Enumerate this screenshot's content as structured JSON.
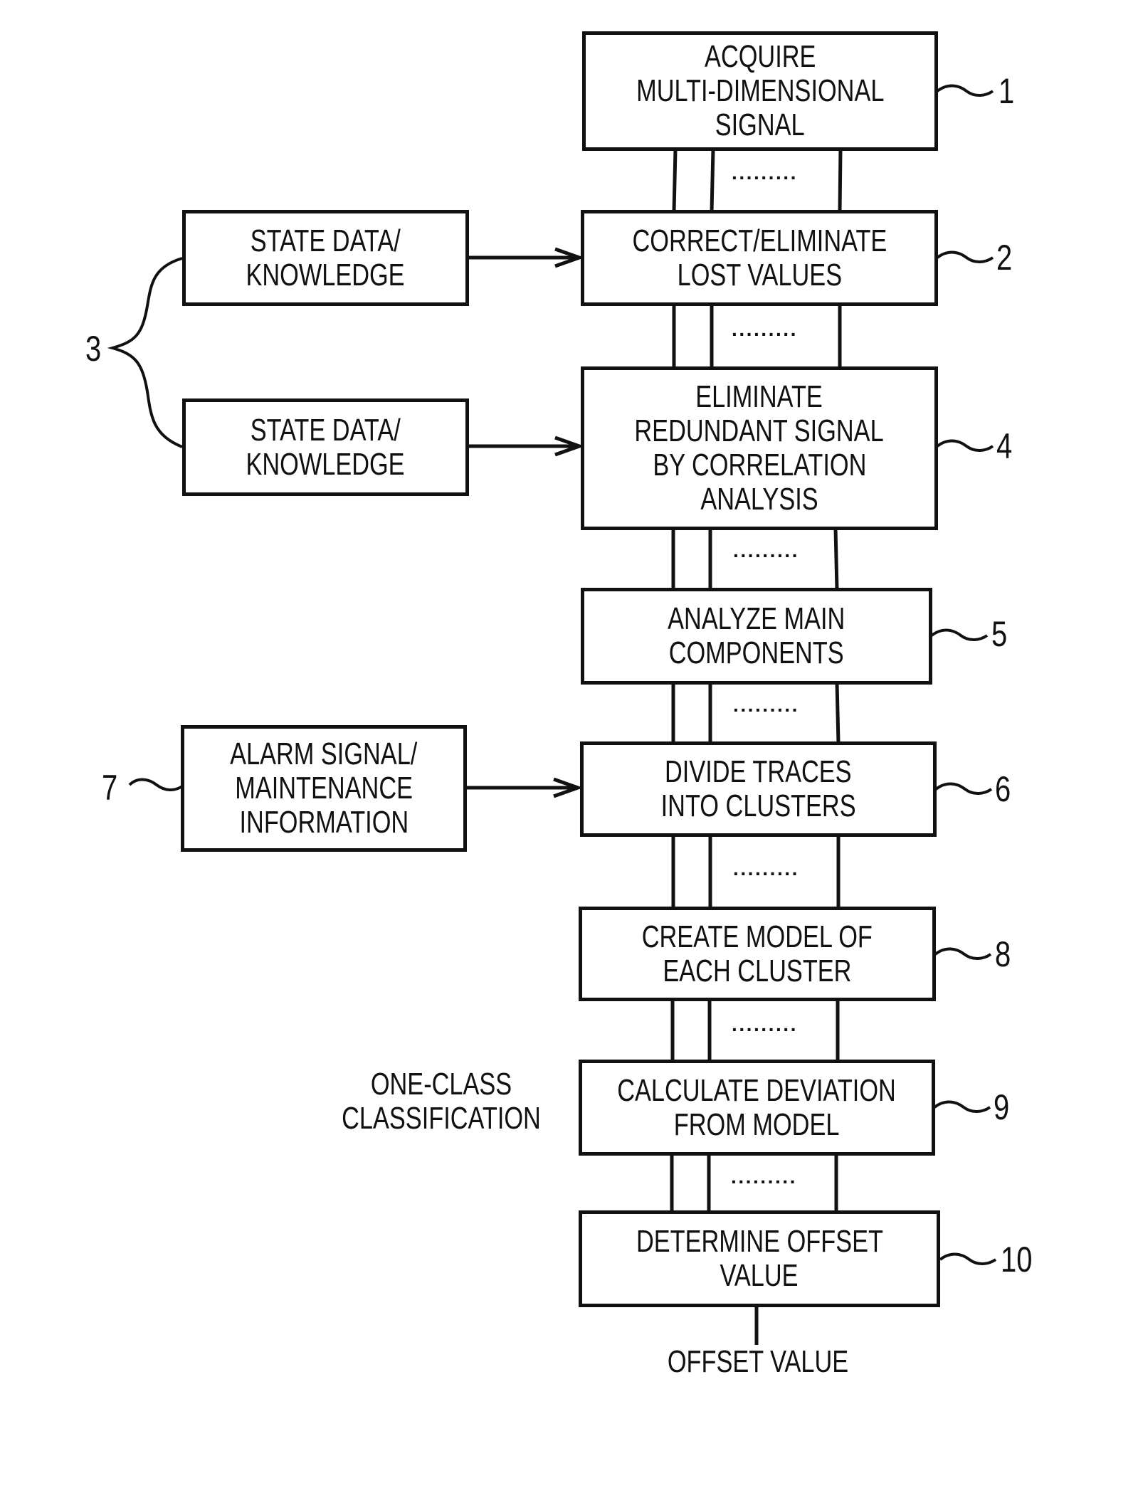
{
  "figure": {
    "main_steps": [
      {
        "ref": "1",
        "lines": [
          "ACQUIRE",
          "MULTI-DIMENSIONAL",
          "SIGNAL"
        ]
      },
      {
        "ref": "2",
        "lines": [
          "CORRECT/ELIMINATE",
          "LOST VALUES"
        ]
      },
      {
        "ref": "4",
        "lines": [
          "ELIMINATE",
          "REDUNDANT SIGNAL",
          "BY CORRELATION",
          "ANALYSIS"
        ]
      },
      {
        "ref": "5",
        "lines": [
          "ANALYZE MAIN",
          "COMPONENTS"
        ]
      },
      {
        "ref": "6",
        "lines": [
          "DIVIDE TRACES",
          "INTO CLUSTERS"
        ]
      },
      {
        "ref": "8",
        "lines": [
          "CREATE MODEL OF",
          "EACH CLUSTER"
        ]
      },
      {
        "ref": "9",
        "lines": [
          "CALCULATE DEVIATION",
          "FROM MODEL"
        ]
      },
      {
        "ref": "10",
        "lines": [
          "DETERMINE OFFSET",
          "VALUE"
        ]
      }
    ],
    "inputs": [
      {
        "lines": [
          "STATE DATA/",
          "KNOWLEDGE"
        ],
        "target_ref": "2"
      },
      {
        "lines": [
          "STATE DATA/",
          "KNOWLEDGE"
        ],
        "target_ref": "4"
      },
      {
        "ref": "7",
        "lines": [
          "ALARM SIGNAL/",
          "MAINTENANCE",
          "INFORMATION"
        ],
        "target_ref": "6"
      }
    ],
    "group_ref": "3",
    "side_note": [
      "ONE-CLASS",
      "CLASSIFICATION"
    ],
    "output_label": "OFFSET VALUE",
    "ellipsis": "·········"
  }
}
